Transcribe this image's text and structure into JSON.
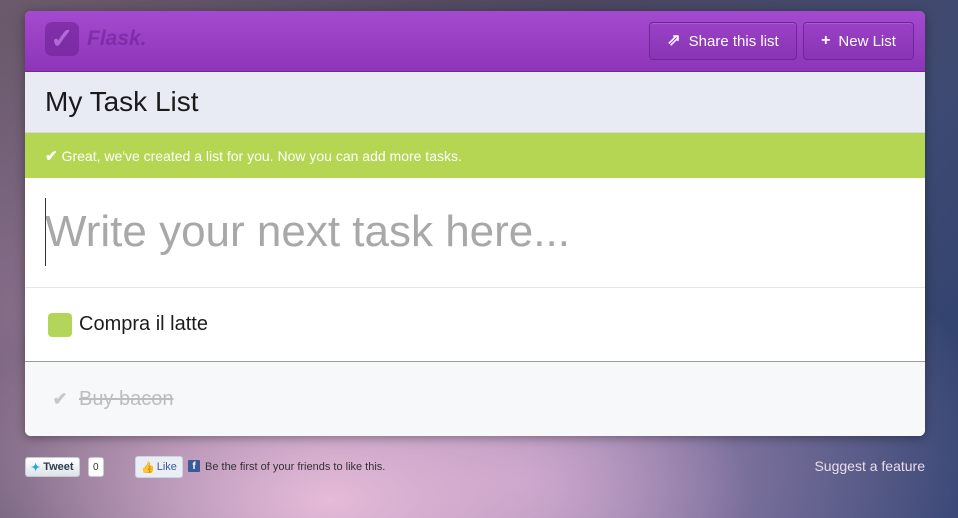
{
  "header": {
    "logo_text": "Flask.",
    "share_label": "Share this list",
    "new_list_label": "New List",
    "brand_color": "#9b42c8"
  },
  "list": {
    "title": "My Task List"
  },
  "notice": {
    "text": "Great, we've created a list for you. Now you can add more tasks.",
    "color": "#b5d652"
  },
  "task_input": {
    "placeholder": "Write your next task here..."
  },
  "tasks": [
    {
      "label": "Compra il latte",
      "done": false
    },
    {
      "label": "Buy bacon",
      "done": true
    }
  ],
  "footer": {
    "tweet_label": "Tweet",
    "tweet_count": "0",
    "like_label": "Like",
    "facebook_text": "Be the first of your friends to like this.",
    "suggest_label": "Suggest a feature"
  }
}
